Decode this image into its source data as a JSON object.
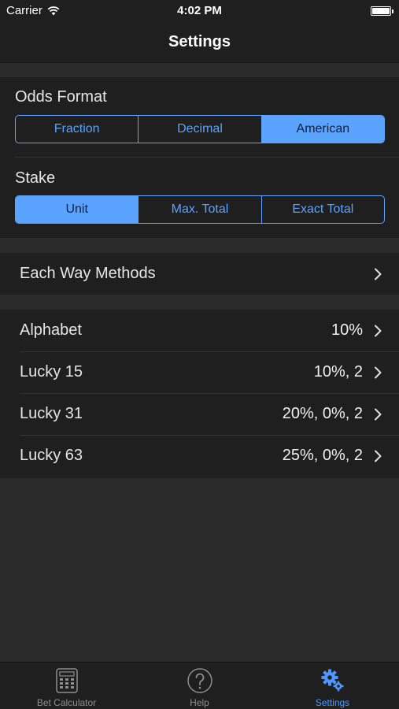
{
  "status_bar": {
    "carrier": "Carrier",
    "time": "4:02 PM"
  },
  "nav": {
    "title": "Settings"
  },
  "odds_format": {
    "heading": "Odds Format",
    "options": [
      "Fraction",
      "Decimal",
      "American"
    ],
    "selected": "American"
  },
  "stake": {
    "heading": "Stake",
    "options": [
      "Unit",
      "Max. Total",
      "Exact Total"
    ],
    "selected": "Unit"
  },
  "each_way": {
    "label": "Each Way Methods"
  },
  "methods": [
    {
      "label": "Alphabet",
      "value": "10%"
    },
    {
      "label": "Lucky 15",
      "value": "10%, 2"
    },
    {
      "label": "Lucky 31",
      "value": "20%, 0%, 2"
    },
    {
      "label": "Lucky 63",
      "value": "25%, 0%, 2"
    }
  ],
  "tabs": [
    {
      "label": "Bet Calculator",
      "icon": "calculator-icon"
    },
    {
      "label": "Help",
      "icon": "help-icon"
    },
    {
      "label": "Settings",
      "icon": "gears-icon",
      "active": true
    }
  ],
  "colors": {
    "accent": "#5aa3ff",
    "background": "#2b2b2b",
    "panel": "#1f1f1f",
    "tab_active": "#4f96ff"
  }
}
